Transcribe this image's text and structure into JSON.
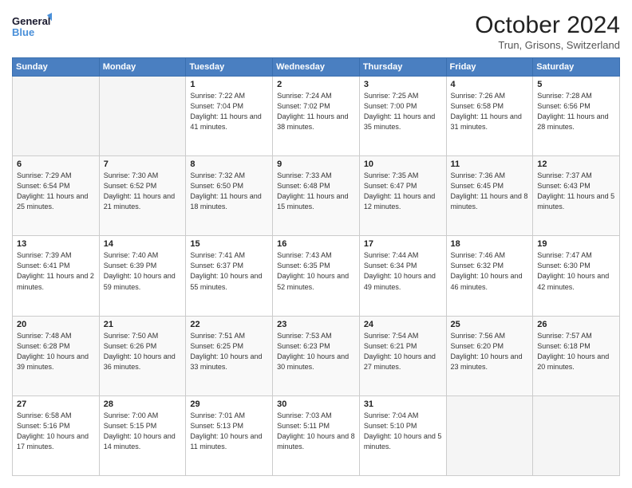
{
  "header": {
    "logo_general": "General",
    "logo_blue": "Blue",
    "month_title": "October 2024",
    "location": "Trun, Grisons, Switzerland"
  },
  "weekdays": [
    "Sunday",
    "Monday",
    "Tuesday",
    "Wednesday",
    "Thursday",
    "Friday",
    "Saturday"
  ],
  "weeks": [
    [
      {
        "day": "",
        "empty": true
      },
      {
        "day": "",
        "empty": true
      },
      {
        "day": "1",
        "sunrise": "7:22 AM",
        "sunset": "7:04 PM",
        "daylight": "11 hours and 41 minutes."
      },
      {
        "day": "2",
        "sunrise": "7:24 AM",
        "sunset": "7:02 PM",
        "daylight": "11 hours and 38 minutes."
      },
      {
        "day": "3",
        "sunrise": "7:25 AM",
        "sunset": "7:00 PM",
        "daylight": "11 hours and 35 minutes."
      },
      {
        "day": "4",
        "sunrise": "7:26 AM",
        "sunset": "6:58 PM",
        "daylight": "11 hours and 31 minutes."
      },
      {
        "day": "5",
        "sunrise": "7:28 AM",
        "sunset": "6:56 PM",
        "daylight": "11 hours and 28 minutes."
      }
    ],
    [
      {
        "day": "6",
        "sunrise": "7:29 AM",
        "sunset": "6:54 PM",
        "daylight": "11 hours and 25 minutes."
      },
      {
        "day": "7",
        "sunrise": "7:30 AM",
        "sunset": "6:52 PM",
        "daylight": "11 hours and 21 minutes."
      },
      {
        "day": "8",
        "sunrise": "7:32 AM",
        "sunset": "6:50 PM",
        "daylight": "11 hours and 18 minutes."
      },
      {
        "day": "9",
        "sunrise": "7:33 AM",
        "sunset": "6:48 PM",
        "daylight": "11 hours and 15 minutes."
      },
      {
        "day": "10",
        "sunrise": "7:35 AM",
        "sunset": "6:47 PM",
        "daylight": "11 hours and 12 minutes."
      },
      {
        "day": "11",
        "sunrise": "7:36 AM",
        "sunset": "6:45 PM",
        "daylight": "11 hours and 8 minutes."
      },
      {
        "day": "12",
        "sunrise": "7:37 AM",
        "sunset": "6:43 PM",
        "daylight": "11 hours and 5 minutes."
      }
    ],
    [
      {
        "day": "13",
        "sunrise": "7:39 AM",
        "sunset": "6:41 PM",
        "daylight": "11 hours and 2 minutes."
      },
      {
        "day": "14",
        "sunrise": "7:40 AM",
        "sunset": "6:39 PM",
        "daylight": "10 hours and 59 minutes."
      },
      {
        "day": "15",
        "sunrise": "7:41 AM",
        "sunset": "6:37 PM",
        "daylight": "10 hours and 55 minutes."
      },
      {
        "day": "16",
        "sunrise": "7:43 AM",
        "sunset": "6:35 PM",
        "daylight": "10 hours and 52 minutes."
      },
      {
        "day": "17",
        "sunrise": "7:44 AM",
        "sunset": "6:34 PM",
        "daylight": "10 hours and 49 minutes."
      },
      {
        "day": "18",
        "sunrise": "7:46 AM",
        "sunset": "6:32 PM",
        "daylight": "10 hours and 46 minutes."
      },
      {
        "day": "19",
        "sunrise": "7:47 AM",
        "sunset": "6:30 PM",
        "daylight": "10 hours and 42 minutes."
      }
    ],
    [
      {
        "day": "20",
        "sunrise": "7:48 AM",
        "sunset": "6:28 PM",
        "daylight": "10 hours and 39 minutes."
      },
      {
        "day": "21",
        "sunrise": "7:50 AM",
        "sunset": "6:26 PM",
        "daylight": "10 hours and 36 minutes."
      },
      {
        "day": "22",
        "sunrise": "7:51 AM",
        "sunset": "6:25 PM",
        "daylight": "10 hours and 33 minutes."
      },
      {
        "day": "23",
        "sunrise": "7:53 AM",
        "sunset": "6:23 PM",
        "daylight": "10 hours and 30 minutes."
      },
      {
        "day": "24",
        "sunrise": "7:54 AM",
        "sunset": "6:21 PM",
        "daylight": "10 hours and 27 minutes."
      },
      {
        "day": "25",
        "sunrise": "7:56 AM",
        "sunset": "6:20 PM",
        "daylight": "10 hours and 23 minutes."
      },
      {
        "day": "26",
        "sunrise": "7:57 AM",
        "sunset": "6:18 PM",
        "daylight": "10 hours and 20 minutes."
      }
    ],
    [
      {
        "day": "27",
        "sunrise": "6:58 AM",
        "sunset": "5:16 PM",
        "daylight": "10 hours and 17 minutes."
      },
      {
        "day": "28",
        "sunrise": "7:00 AM",
        "sunset": "5:15 PM",
        "daylight": "10 hours and 14 minutes."
      },
      {
        "day": "29",
        "sunrise": "7:01 AM",
        "sunset": "5:13 PM",
        "daylight": "10 hours and 11 minutes."
      },
      {
        "day": "30",
        "sunrise": "7:03 AM",
        "sunset": "5:11 PM",
        "daylight": "10 hours and 8 minutes."
      },
      {
        "day": "31",
        "sunrise": "7:04 AM",
        "sunset": "5:10 PM",
        "daylight": "10 hours and 5 minutes."
      },
      {
        "day": "",
        "empty": true
      },
      {
        "day": "",
        "empty": true
      }
    ]
  ]
}
